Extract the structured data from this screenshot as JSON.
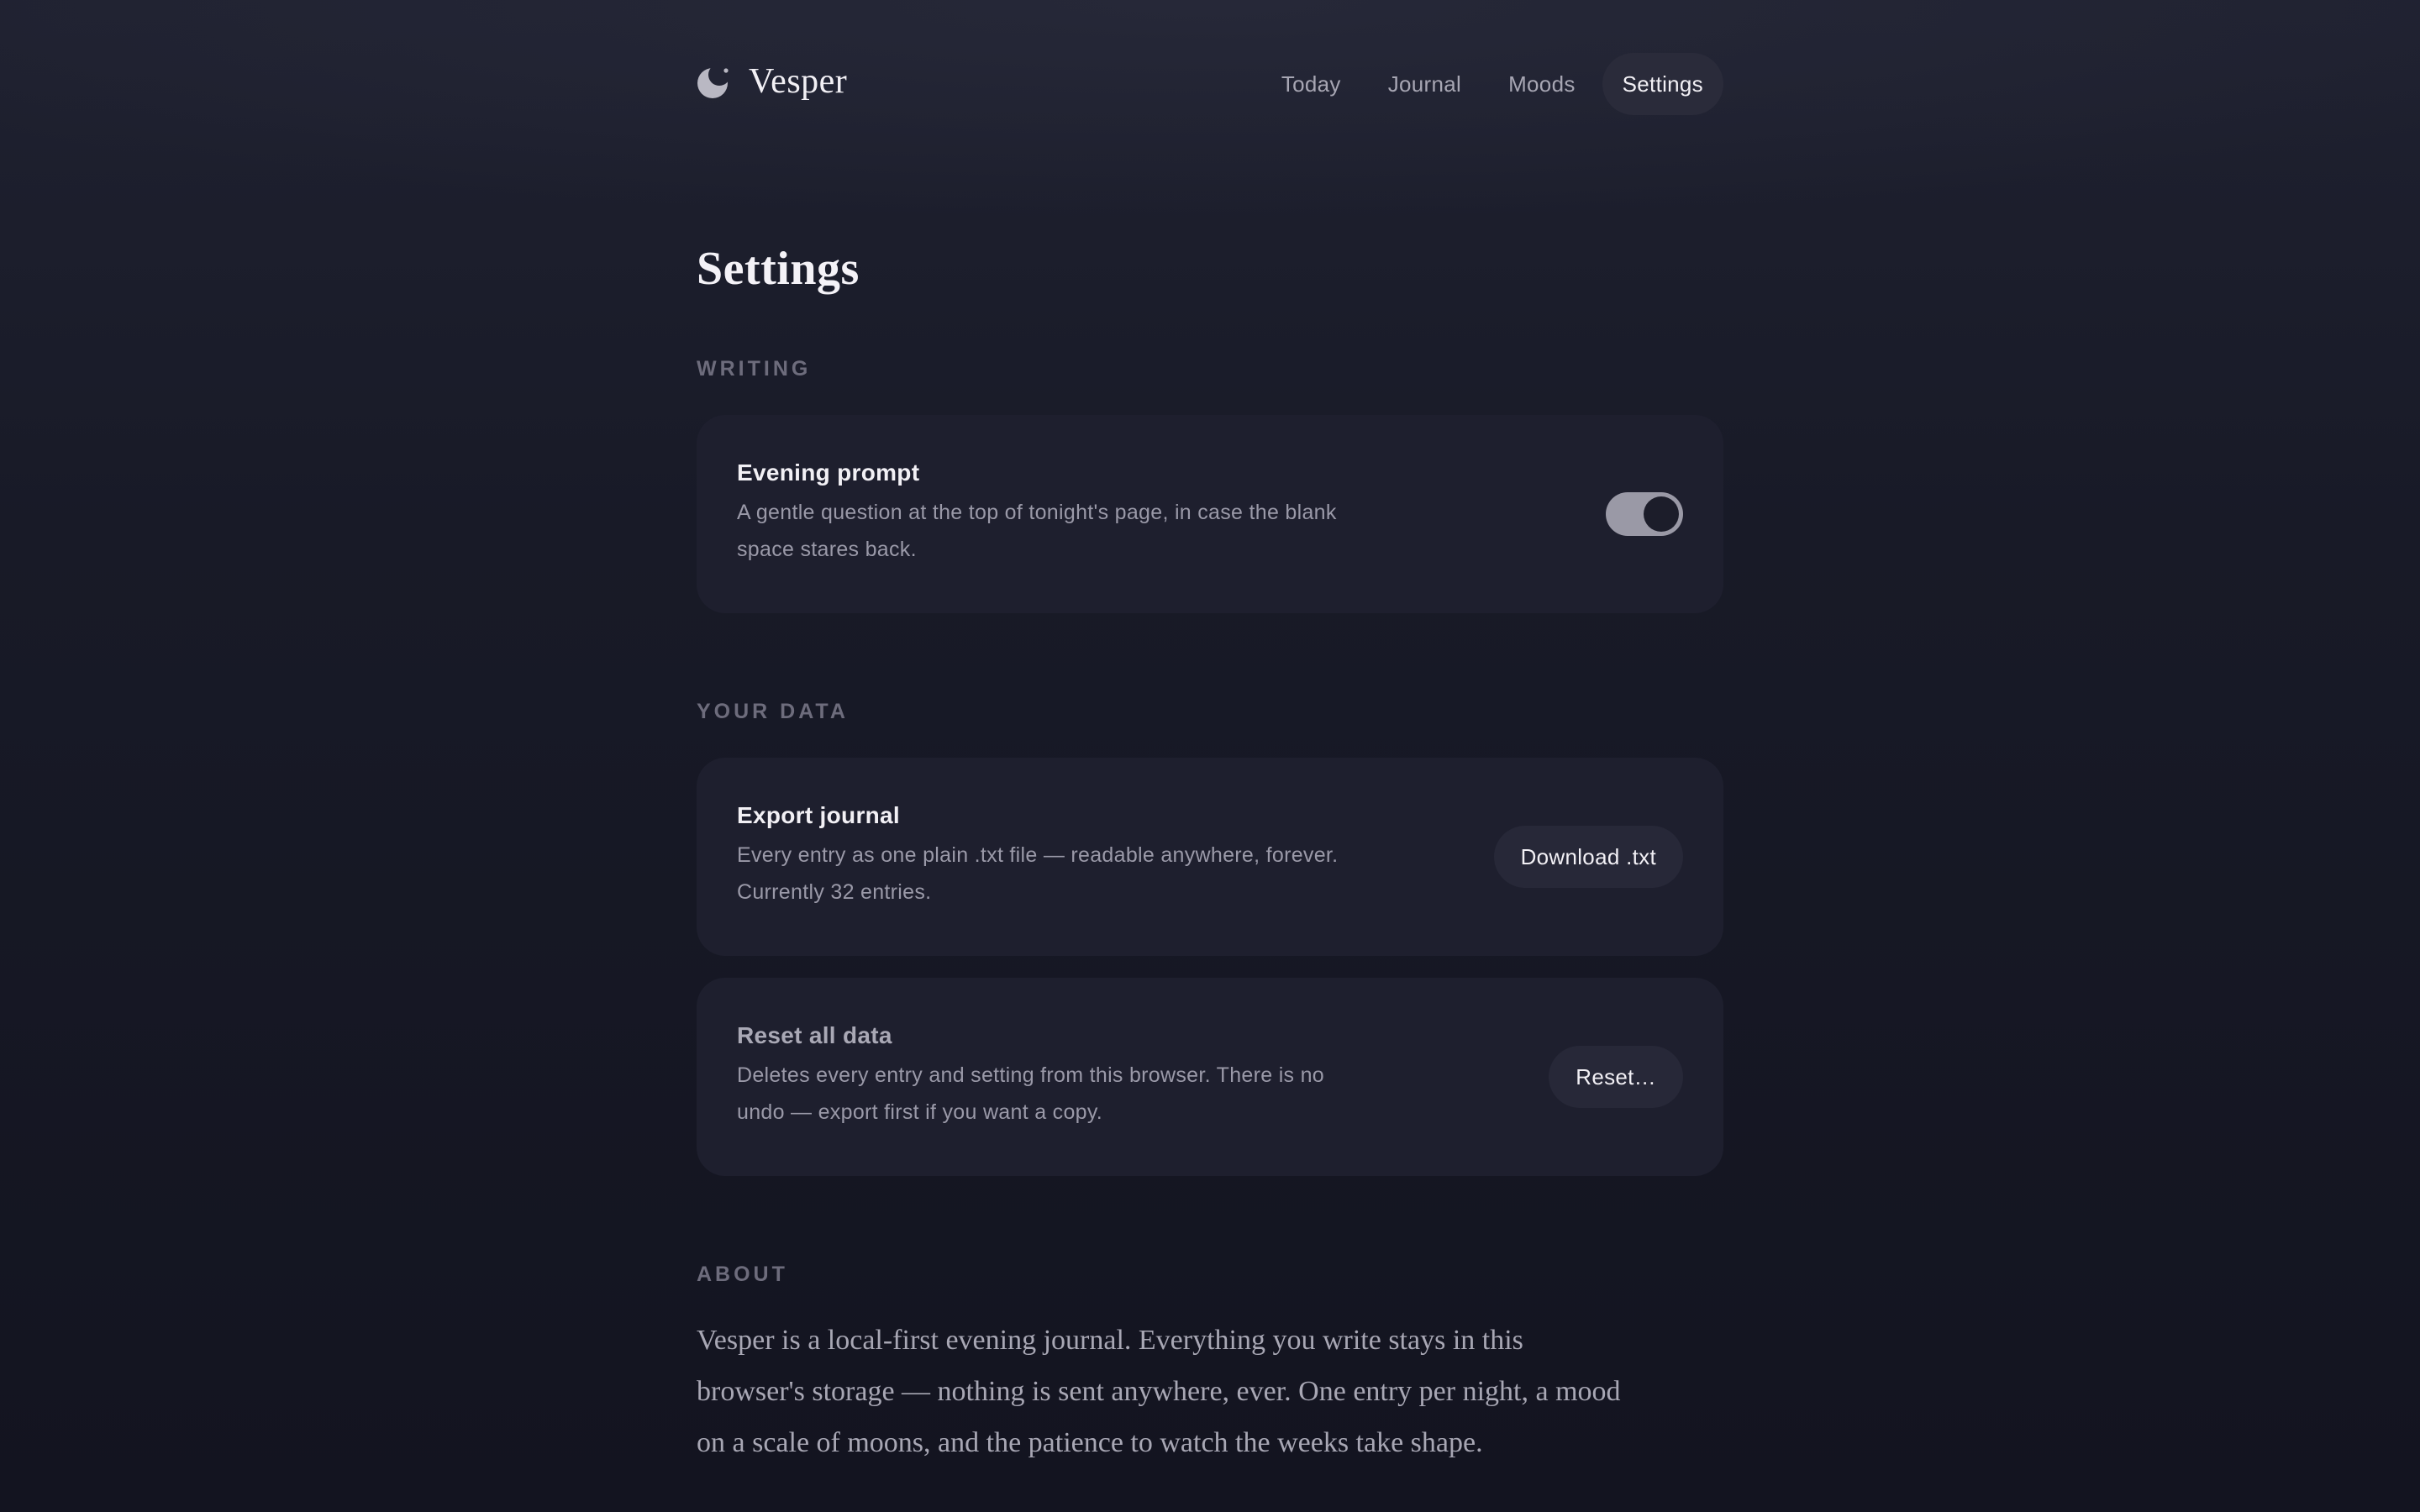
{
  "app": {
    "name": "Vesper",
    "logo_icon": "crescent-moon-icon"
  },
  "nav": {
    "items": [
      {
        "label": "Today"
      },
      {
        "label": "Journal"
      },
      {
        "label": "Moods"
      },
      {
        "label": "Settings",
        "active": true
      }
    ]
  },
  "page": {
    "title": "Settings"
  },
  "sections": {
    "writing": {
      "label": "WRITING",
      "evening_prompt": {
        "title": "Evening prompt",
        "description": "A gentle question at the top of tonight's page, in case the blank space stares back.",
        "enabled": true
      }
    },
    "your_data": {
      "label": "YOUR DATA",
      "export": {
        "title": "Export journal",
        "description": "Every entry as one plain .txt file — readable anywhere, forever. Currently 32 entries.",
        "button_label": "Download .txt"
      },
      "reset": {
        "title": "Reset all data",
        "description": "Deletes every entry and setting from this browser. There is no undo — export first if you want a copy.",
        "button_label": "Reset…"
      }
    },
    "about": {
      "label": "ABOUT",
      "text": "Vesper is a local-first evening journal. Everything you write stays in this browser's storage — nothing is sent anywhere, ever. One entry per night, a mood on a scale of moons, and the patience to watch the weeks take shape."
    }
  },
  "colors": {
    "background": "#161724",
    "card": "#1e1f2e",
    "active_nav": "#2a2b3a",
    "toggle_on": "#9a99a6"
  }
}
